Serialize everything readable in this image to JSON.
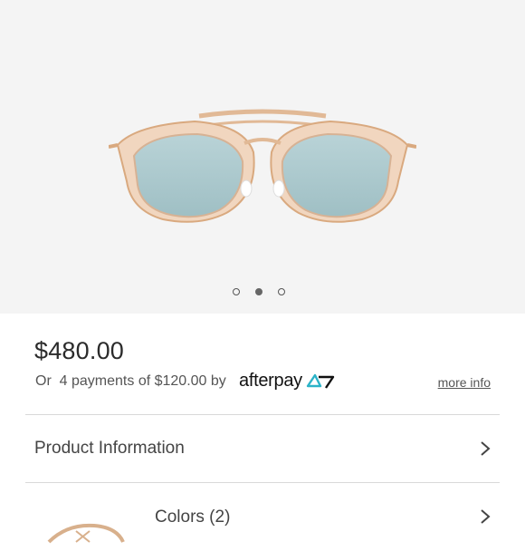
{
  "product": {
    "image_alt": "sunglasses",
    "carousel": {
      "count": 3,
      "active": 2
    },
    "price": "$480.00",
    "installments_text": "Or  4 payments of $120.00 by",
    "afterpay_brand": "afterpay",
    "more_info": "more info"
  },
  "sections": {
    "product_information": "Product Information",
    "colors": "Colors (2)"
  },
  "colors": {
    "frame_gold": "#e0b793",
    "lens": "#a9c7cc",
    "afterpay_accent": "#2bb3c8"
  }
}
